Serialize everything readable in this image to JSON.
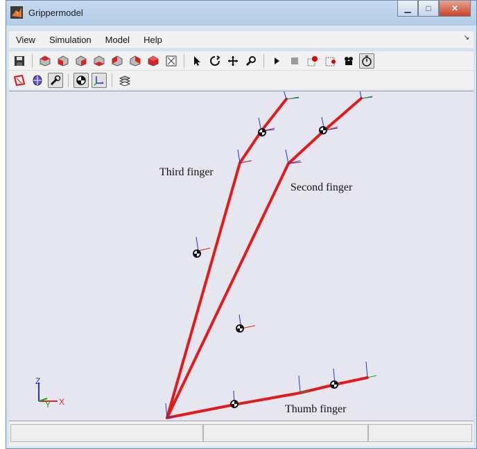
{
  "window": {
    "title": "Grippermodel"
  },
  "menu": {
    "items": [
      "View",
      "Simulation",
      "Model",
      "Help"
    ],
    "corner_glyph": "↘"
  },
  "toolbar1": {
    "icons": [
      "save-icon",
      "cube-view-icon-1",
      "cube-view-icon-2",
      "cube-view-icon-3",
      "cube-view-icon-4",
      "cube-view-icon-5",
      "cube-view-icon-6",
      "cube-view-icon-7",
      "fit-view-icon",
      "pointer-icon",
      "rotate-icon",
      "pan-icon",
      "zoom-icon",
      "play-icon",
      "stop-icon",
      "record-start-icon",
      "record-stop-icon",
      "camera-icon",
      "timer-icon"
    ]
  },
  "toolbar2": {
    "icons": [
      "red-frame-icon",
      "globe-icon",
      "wrench-icon",
      "center-of-mass-icon",
      "axes-icon",
      "layers-icon"
    ]
  },
  "scene": {
    "labels": {
      "third": "Third finger",
      "second": "Second finger",
      "thumb": "Thumb finger"
    },
    "axes": {
      "z": "Z",
      "y": "Y",
      "x": "X"
    },
    "colors": {
      "link": "#e31a1a",
      "background": "#e6e6f0",
      "z_axis": "#2233cc",
      "y_axis": "#11aa11",
      "x_axis": "#dd2222"
    }
  }
}
